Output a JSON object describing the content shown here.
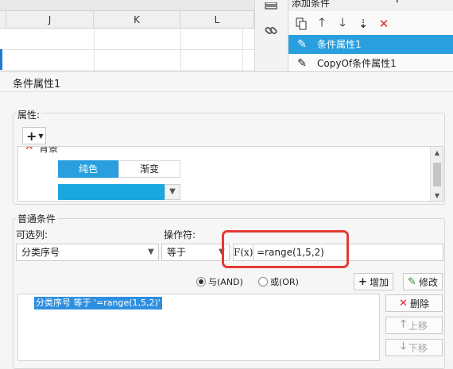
{
  "sheet": {
    "columns": [
      "J",
      "K",
      "L"
    ]
  },
  "condition_panel": {
    "title": "添加条件",
    "items": [
      {
        "label": "条件属性1",
        "selected": true
      },
      {
        "label": "CopyOf条件属性1",
        "selected": false
      }
    ]
  },
  "dialog": {
    "title": "条件属性1",
    "attributes": {
      "label": "属性:",
      "cut_text": "背景",
      "tabs": [
        "纯色",
        "渐变"
      ],
      "selected_tab": "纯色",
      "color": "#1aa7dd"
    },
    "condition": {
      "label": "普通条件",
      "column_label": "可选列:",
      "column_value": "分类序号",
      "operator_label": "操作符:",
      "operator_value": "等于",
      "fx_label": "F(x)",
      "formula_value": "=range(1,5,2)",
      "and_label": "与(AND)",
      "or_label": "或(OR)",
      "and_selected": true,
      "add_label": "增加",
      "modify_label": "修改",
      "delete_label": "删除",
      "up_label": "上移",
      "down_label": "下移",
      "expression": "分类序号 等于 '=range(1,5,2)'"
    }
  },
  "colors": {
    "accent": "#2a9fe0",
    "highlight": "#e53935",
    "delete": "#d9282a",
    "selected_row": "#2e8fe0"
  }
}
